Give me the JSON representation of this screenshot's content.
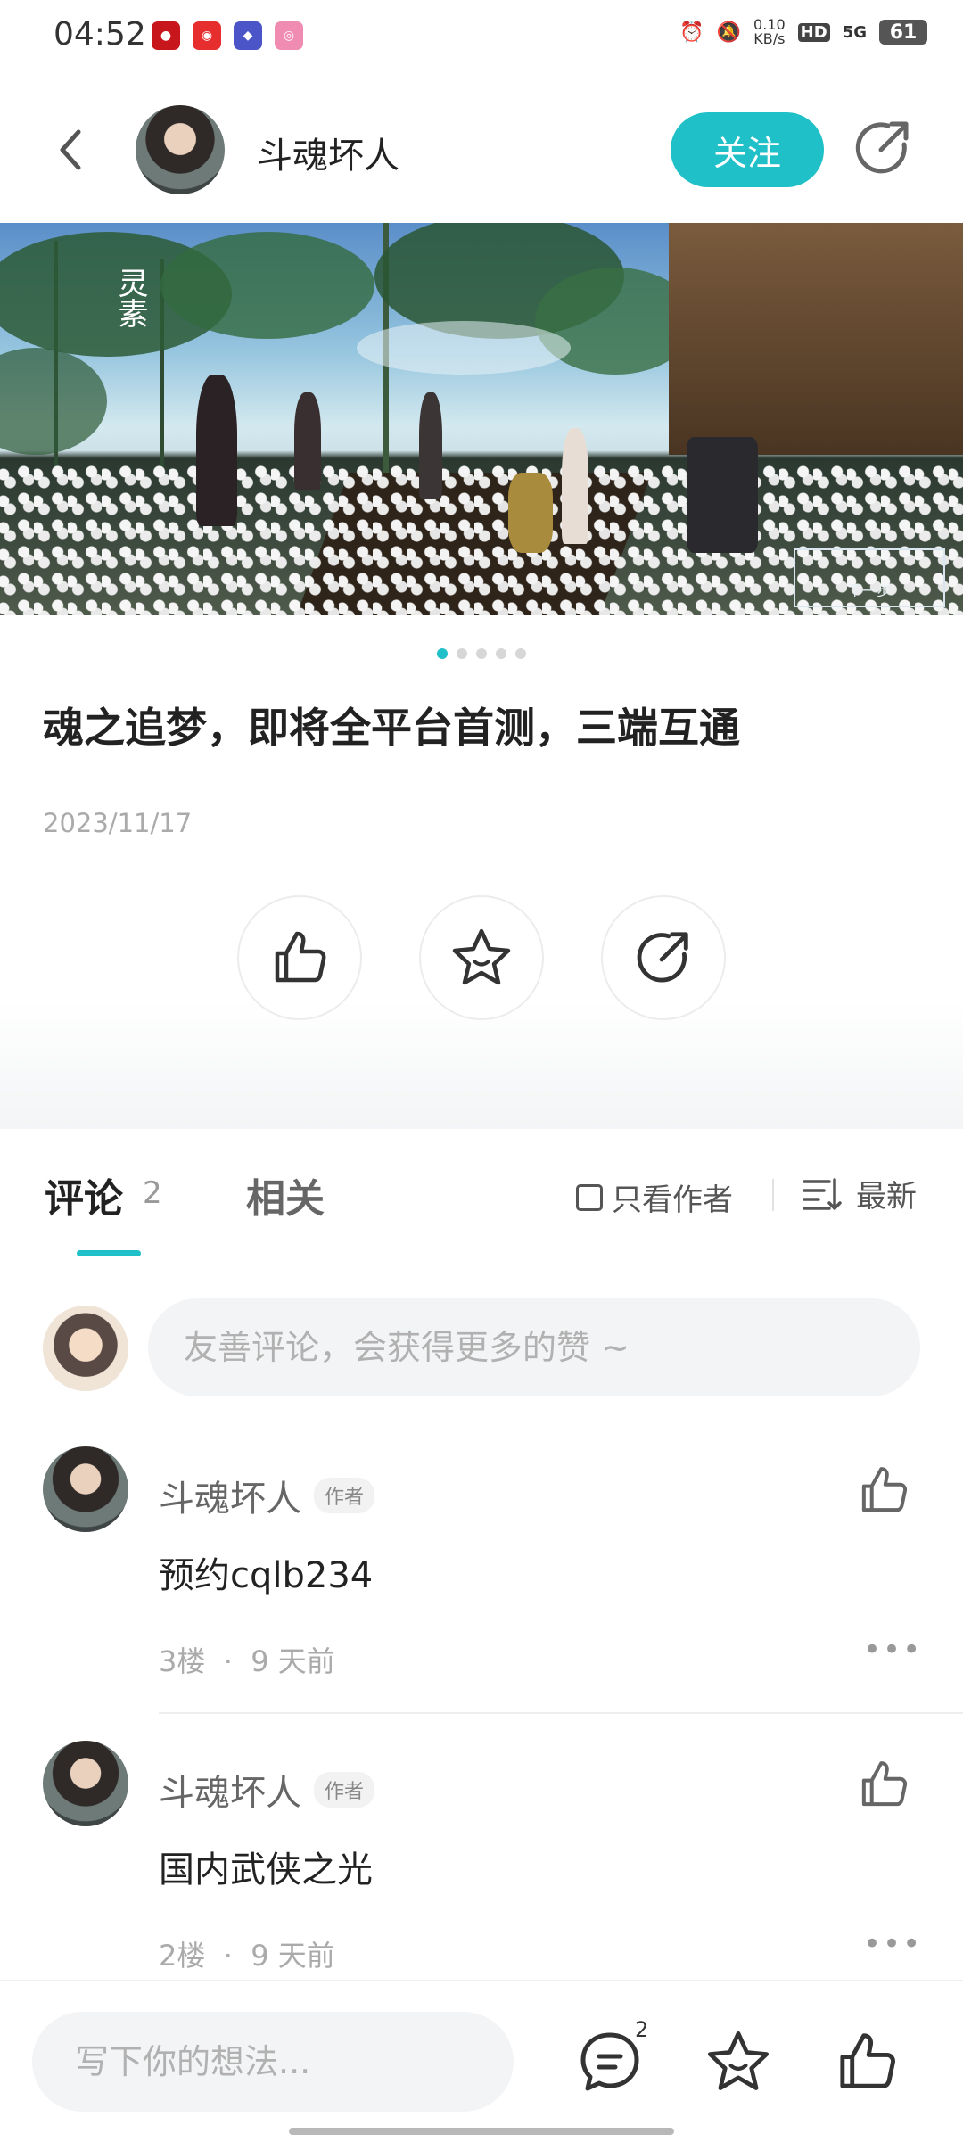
{
  "status_bar": {
    "time": "04:52",
    "net_speed_value": "0.10",
    "net_speed_unit": "KB/s",
    "hd": "HD",
    "signal": "5G",
    "battery": "61"
  },
  "header": {
    "title": "斗魂坏人",
    "follow_label": "关注"
  },
  "banner": {
    "vertical_title": "灵素",
    "next_label": "下一步",
    "page_count": 5,
    "active_page": 0
  },
  "post": {
    "title": "魂之追梦，即将全平台首测，三端互通",
    "date": "2023/11/17"
  },
  "tabs": {
    "comment_label": "评论",
    "comment_count": "2",
    "related_label": "相关",
    "only_author_label": "只看作者",
    "sort_label": "最新"
  },
  "comment_input": {
    "placeholder": "友善评论，会获得更多的赞 ~"
  },
  "comments": [
    {
      "author": "斗魂坏人",
      "badge": "作者",
      "text": "预约cqlb234",
      "floor": "3楼",
      "time": "9 天前"
    },
    {
      "author": "斗魂坏人",
      "badge": "作者",
      "text": "国内武侠之光",
      "floor": "2楼",
      "time": "9 天前"
    }
  ],
  "bottom_bar": {
    "placeholder": "写下你的想法...",
    "comment_badge": "2"
  },
  "colors": {
    "accent": "#1fc0c8"
  }
}
